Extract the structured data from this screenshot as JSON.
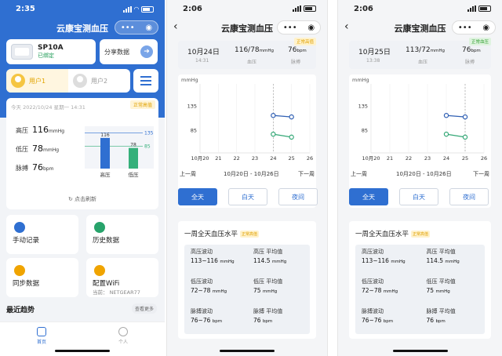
{
  "phone1": {
    "status_time": "2:35",
    "title": "云康宝测血压",
    "device": {
      "name": "SP10A",
      "status": "已绑定"
    },
    "share_label": "分享数据",
    "users": [
      "用户1",
      "用户2"
    ],
    "measurement": {
      "datetime": "今天 2022/10/24 星期一 14:31",
      "badge": "正常高值",
      "rows": [
        {
          "label": "高压",
          "value": "116",
          "unit": "mmHg"
        },
        {
          "label": "低压",
          "value": "78",
          "unit": "mmHg"
        },
        {
          "label": "脉搏",
          "value": "76",
          "unit": "bpm"
        }
      ],
      "bars": [
        {
          "label": "高压",
          "value": 116,
          "color": "#2f6fd1"
        },
        {
          "label": "低压",
          "value": 78,
          "color": "#35b07a"
        }
      ],
      "ref_high": "135",
      "ref_low": "85",
      "refresh": "点击刷新"
    },
    "grid": [
      {
        "label": "手动记录",
        "sub": "",
        "icon": "pencil-icon",
        "color": "#2f6fd1"
      },
      {
        "label": "历史数据",
        "sub": "",
        "icon": "clock-icon",
        "color": "#27a36b"
      },
      {
        "label": "同步数据",
        "sub": "",
        "icon": "cloud-sync-icon",
        "color": "#f0a400"
      },
      {
        "label": "配置WiFi",
        "sub": "当前： NETGEAR77",
        "icon": "wifi-icon",
        "color": "#f0a400"
      }
    ],
    "trend_title": "最近趋势",
    "more": "查看更多",
    "tabs": [
      "首页",
      "个人"
    ]
  },
  "phone2": {
    "status_time": "2:06",
    "title": "云康宝测血压",
    "summary": {
      "date": "10月24日",
      "time": "14:31",
      "bp": "116/78",
      "bp_unit": "mmHg",
      "bp_label": "血压",
      "pulse": "76",
      "pulse_unit": "bpm",
      "pulse_label": "脉搏",
      "badge": "正常高值"
    },
    "chart_unit": "mmHg",
    "prev_week": "上一周",
    "week_range": "10月20日 - 10月26日",
    "next_week": "下一周",
    "buttons": [
      "全天",
      "白天",
      "夜间"
    ],
    "stats_title": "一周全天血压水平",
    "stats_badge": "正常高值",
    "stats": [
      {
        "label": "高压波动",
        "value": "113~116",
        "unit": "mmHg"
      },
      {
        "label": "高压 平均值",
        "value": "114.5",
        "unit": "mmHg"
      },
      {
        "label": "低压波动",
        "value": "72~78",
        "unit": "mmHg"
      },
      {
        "label": "低压 平均值",
        "value": "75",
        "unit": "mmHg"
      },
      {
        "label": "脉搏波动",
        "value": "76~76",
        "unit": "bpm"
      },
      {
        "label": "脉搏 平均值",
        "value": "76",
        "unit": "bpm"
      }
    ]
  },
  "phone3": {
    "status_time": "2:06",
    "title": "云康宝测血压",
    "summary": {
      "date": "10月25日",
      "time": "13:38",
      "bp": "113/72",
      "bp_unit": "mmHg",
      "bp_label": "血压",
      "pulse": "76",
      "pulse_unit": "bpm",
      "pulse_label": "脉搏",
      "badge": "正常血压"
    },
    "chart_unit": "mmHg",
    "prev_week": "上一周",
    "week_range": "10月20日 - 10月26日",
    "next_week": "下一周",
    "buttons": [
      "全天",
      "白天",
      "夜间"
    ],
    "stats_title": "一周全天血压水平",
    "stats_badge": "正常高值",
    "stats": [
      {
        "label": "高压波动",
        "value": "113~116",
        "unit": "mmHg"
      },
      {
        "label": "高压 平均值",
        "value": "114.5",
        "unit": "mmHg"
      },
      {
        "label": "低压波动",
        "value": "72~78",
        "unit": "mmHg"
      },
      {
        "label": "低压 平均值",
        "value": "75",
        "unit": "mmHg"
      },
      {
        "label": "脉搏波动",
        "value": "76~76",
        "unit": "bpm"
      },
      {
        "label": "脉搏 平均值",
        "value": "76",
        "unit": "bpm"
      }
    ]
  },
  "chart_data": [
    {
      "type": "bar",
      "categories": [
        "高压",
        "低压"
      ],
      "values": [
        116,
        78
      ],
      "reference_lines": [
        135,
        85
      ],
      "ylim": [
        0,
        160
      ]
    },
    {
      "type": "line",
      "ylabel": "mmHg",
      "x": [
        "10月20",
        "21",
        "22",
        "23",
        "24",
        "25",
        "26"
      ],
      "yticks": [
        85,
        135
      ],
      "ylim": [
        40,
        180
      ],
      "series": [
        {
          "color": "#2f5fb3",
          "values": [
            null,
            null,
            null,
            null,
            116,
            113,
            null
          ]
        },
        {
          "color": "#35a877",
          "values": [
            null,
            null,
            null,
            null,
            78,
            72,
            null
          ]
        }
      ],
      "selected": "24"
    },
    {
      "type": "line",
      "ylabel": "mmHg",
      "x": [
        "10月20",
        "21",
        "22",
        "23",
        "24",
        "25",
        "26"
      ],
      "yticks": [
        85,
        135
      ],
      "ylim": [
        40,
        180
      ],
      "series": [
        {
          "color": "#2f5fb3",
          "values": [
            null,
            null,
            null,
            null,
            116,
            113,
            null
          ]
        },
        {
          "color": "#35a877",
          "values": [
            null,
            null,
            null,
            null,
            78,
            72,
            null
          ]
        }
      ],
      "selected": "25"
    }
  ]
}
